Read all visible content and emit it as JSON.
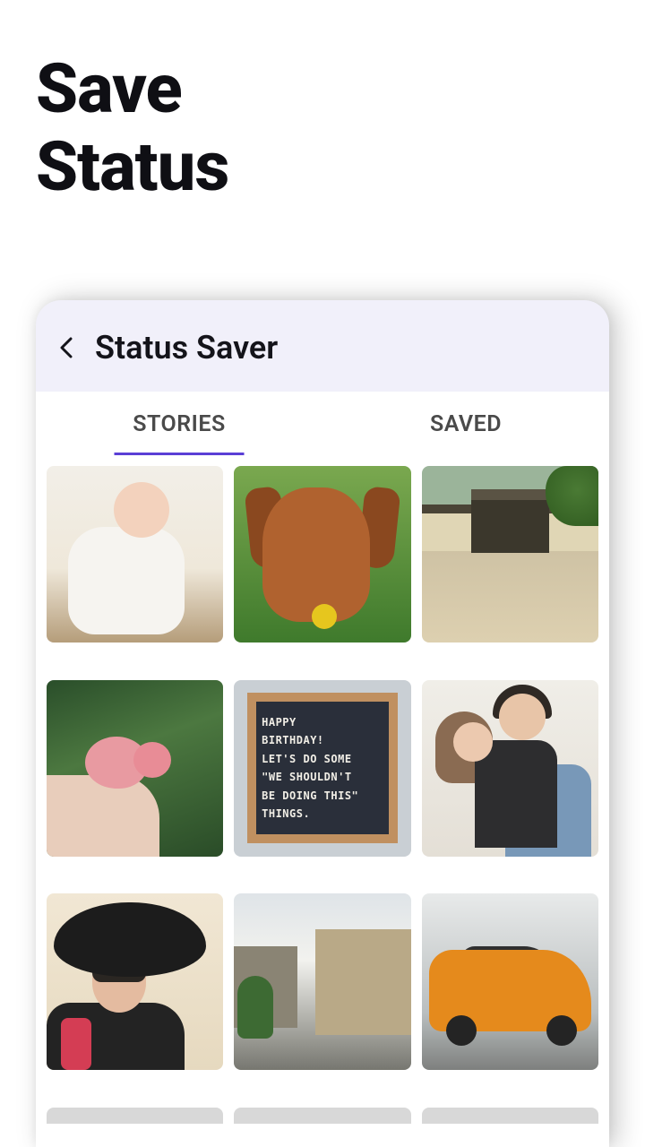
{
  "hero": {
    "line1": "Save",
    "line2": "Status"
  },
  "app": {
    "title": "Status Saver",
    "tabs": {
      "stories": "STORIES",
      "saved": "SAVED",
      "active": "stories"
    },
    "letterboard": {
      "l1": "HAPPY",
      "l2": "BIRTHDAY!",
      "l3": "LET'S DO SOME",
      "l4": "\"WE SHOULDN'T",
      "l5": "BE DOING THIS\"",
      "l6": "THINGS."
    }
  }
}
